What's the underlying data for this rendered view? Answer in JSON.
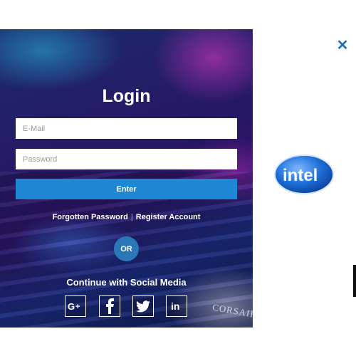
{
  "login": {
    "title": "Login",
    "email_placeholder": "E-Mail",
    "password_placeholder": "Password",
    "enter_label": "Enter",
    "forgot_label": "Forgotten Password",
    "separator": "|",
    "register_label": "Register Account",
    "or_label": "OR",
    "social_title": "Continue with Social Media",
    "social_icons": [
      "google-plus-icon",
      "facebook-icon",
      "twitter-icon",
      "linkedin-icon"
    ],
    "brand_watermark": "CORSAIR"
  },
  "close_icon": "close-icon",
  "ad": {
    "brand": "intel"
  },
  "colors": {
    "accent": "#1e88d4",
    "close": "#1f6fb5",
    "or_badge": "#2b78b9"
  }
}
